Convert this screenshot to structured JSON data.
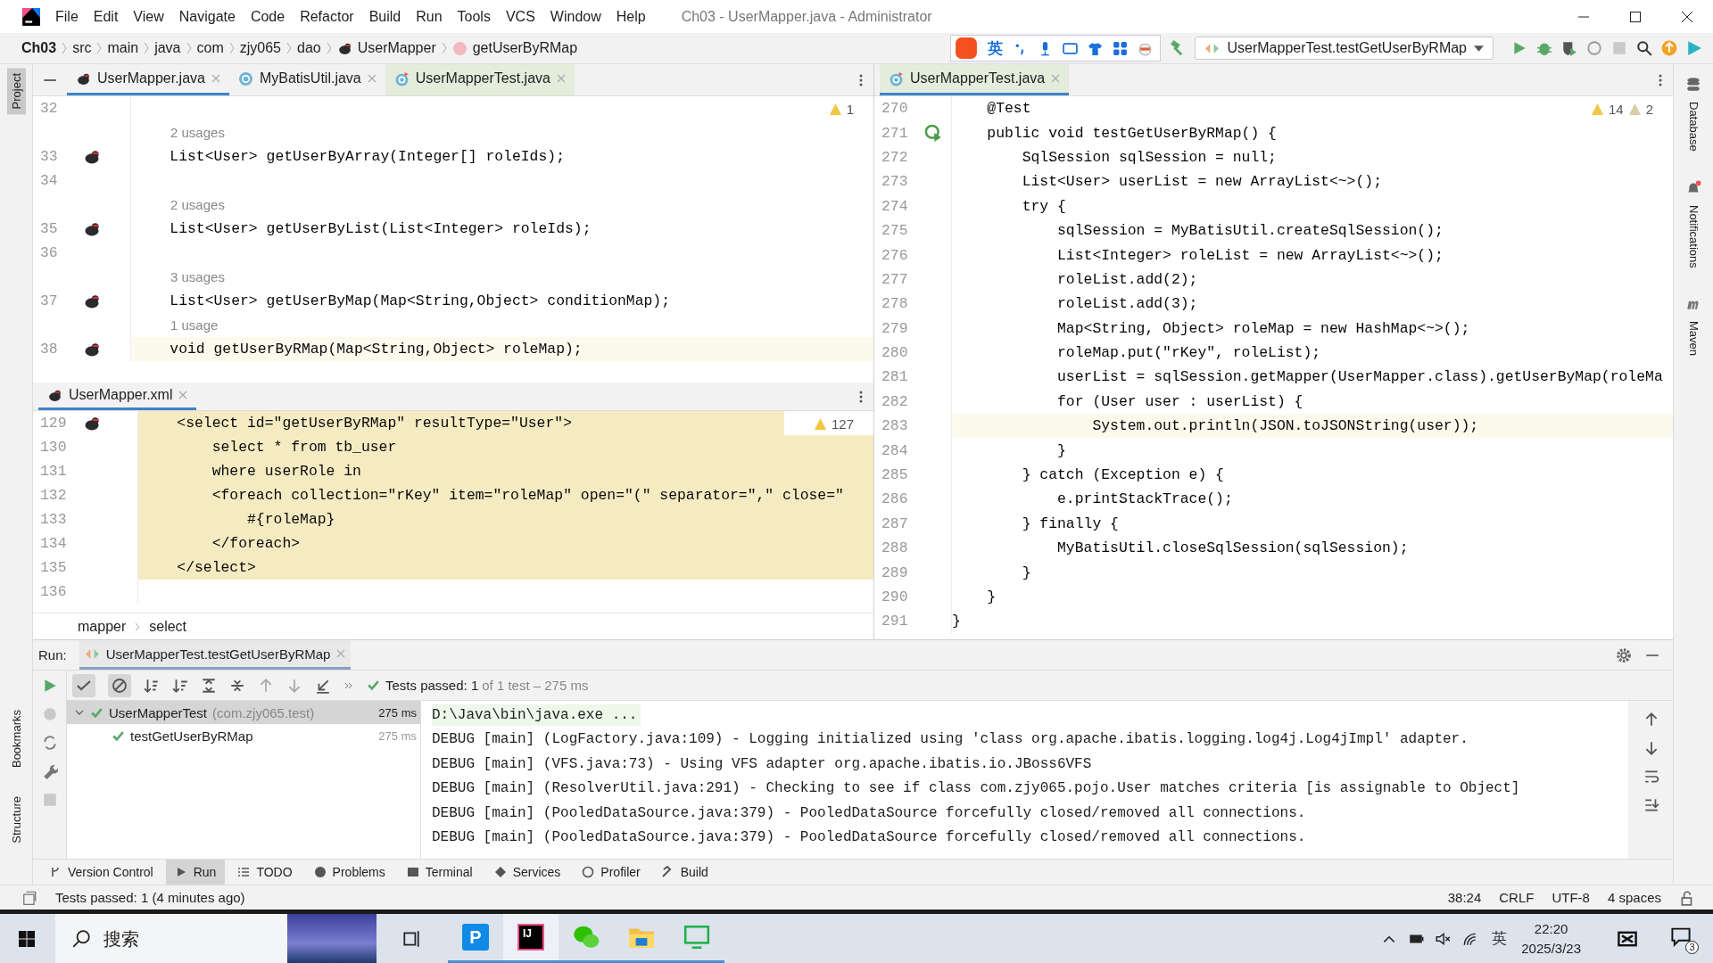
{
  "window": {
    "title": "Ch03 - UserMapper.java - Administrator"
  },
  "menu": [
    "File",
    "Edit",
    "View",
    "Navigate",
    "Code",
    "Refactor",
    "Build",
    "Run",
    "Tools",
    "VCS",
    "Window",
    "Help"
  ],
  "breadcrumb": [
    {
      "label": "Ch03",
      "kind": "project"
    },
    {
      "label": "src",
      "kind": "folder"
    },
    {
      "label": "main",
      "kind": "folder"
    },
    {
      "label": "java",
      "kind": "folder"
    },
    {
      "label": "com",
      "kind": "folder"
    },
    {
      "label": "zjy065",
      "kind": "folder"
    },
    {
      "label": "dao",
      "kind": "folder"
    },
    {
      "label": "UserMapper",
      "kind": "mapper"
    },
    {
      "label": "getUserByRMap",
      "kind": "method"
    }
  ],
  "ime_toolbar": {
    "language": "英"
  },
  "run_config": {
    "label": "UserMapperTest.testGetUserByRMap"
  },
  "left_strip": {
    "top": [
      {
        "label": "Project",
        "selected": true
      }
    ],
    "bottom": [
      {
        "label": "Bookmarks",
        "selected": false
      },
      {
        "label": "Structure",
        "selected": false
      }
    ]
  },
  "right_strip": [
    {
      "label": "Database",
      "kind": "database"
    },
    {
      "label": "Notifications",
      "kind": "bell"
    },
    {
      "label": "Maven",
      "kind": "maven"
    }
  ],
  "left_tabs": [
    {
      "label": "UserMapper.java",
      "selected": true,
      "kind": "mapper"
    },
    {
      "label": "MyBatisUtil.java",
      "selected": false,
      "kind": "class"
    },
    {
      "label": "UserMapperTest.java",
      "selected": false,
      "kind": "test"
    }
  ],
  "right_tabs": [
    {
      "label": "UserMapperTest.java",
      "selected": true,
      "kind": "test"
    }
  ],
  "mapper_editor": {
    "warnings": "1",
    "lines": [
      {
        "number": "32"
      },
      {
        "number": "33",
        "hint": "2 usages",
        "code": "    List<User> getUserByArray(Integer[] roleIds);",
        "mapper_icon": true,
        "current": false
      },
      {
        "number": "34"
      },
      {
        "number": "35",
        "hint": "2 usages",
        "code": "    List<User> getUserByList(List<Integer> roleIds);",
        "mapper_icon": true,
        "current": false
      },
      {
        "number": "36"
      },
      {
        "number": "37",
        "hint": "3 usages",
        "code": "    List<User> getUserByMap(Map<String,Object> conditionMap);",
        "mapper_icon": true,
        "current": false
      },
      {
        "number": "38",
        "hint": "1 usage",
        "code": "    void getUserByRMap(Map<String,Object> roleMap);",
        "mapper_icon": true,
        "current": true
      }
    ]
  },
  "xml_editor": {
    "tab": {
      "label": "UserMapper.xml",
      "selected": true
    },
    "warnings": "127",
    "lines": [
      {
        "number": "129",
        "code": "    <select id=\"getUserByRMap\" resultType=\"User\">",
        "mapper_icon": true,
        "highlighted": true
      },
      {
        "number": "130",
        "code": "        select * from tb_user",
        "highlighted": true
      },
      {
        "number": "131",
        "code": "        where userRole in",
        "highlighted": true
      },
      {
        "number": "132",
        "code": "        <foreach collection=\"rKey\" item=\"roleMap\" open=\"(\" separator=\",\" close=\"",
        "highlighted": true
      },
      {
        "number": "133",
        "code": "            #{roleMap}",
        "highlighted": true
      },
      {
        "number": "134",
        "code": "        </foreach>",
        "highlighted": true
      },
      {
        "number": "135",
        "code": "    </select>",
        "highlighted": true
      },
      {
        "number": "136"
      }
    ],
    "breadcrumb": [
      "mapper",
      "select"
    ]
  },
  "test_editor": {
    "warnings": "14",
    "weak_warnings": "2",
    "lines": [
      {
        "number": "270",
        "code": "    @Test",
        "current": false
      },
      {
        "number": "271",
        "code": "    public void testGetUserByRMap() {",
        "run_icon": true,
        "current": false
      },
      {
        "number": "272",
        "code": "        SqlSession sqlSession = null;",
        "current": false
      },
      {
        "number": "273",
        "code": "        List<User> userList = new ArrayList<~>();",
        "current": false
      },
      {
        "number": "274",
        "code": "        try {",
        "current": false
      },
      {
        "number": "275",
        "code": "            sqlSession = MyBatisUtil.createSqlSession();",
        "current": false
      },
      {
        "number": "276",
        "code": "            List<Integer> roleList = new ArrayList<~>();",
        "current": false
      },
      {
        "number": "277",
        "code": "            roleList.add(2);",
        "current": false
      },
      {
        "number": "278",
        "code": "            roleList.add(3);",
        "current": false
      },
      {
        "number": "279",
        "code": "            Map<String, Object> roleMap = new HashMap<~>();",
        "current": false
      },
      {
        "number": "280",
        "code": "            roleMap.put(\"rKey\", roleList);",
        "current": false
      },
      {
        "number": "281",
        "code": "            userList = sqlSession.getMapper(UserMapper.class).getUserByMap(roleMa",
        "current": false
      },
      {
        "number": "282",
        "code": "            for (User user : userList) {",
        "current": false
      },
      {
        "number": "283",
        "code": "                System.out.println(JSON.toJSONString(user));",
        "current": true
      },
      {
        "number": "284",
        "code": "            }",
        "current": false
      },
      {
        "number": "285",
        "code": "        } catch (Exception e) {",
        "current": false
      },
      {
        "number": "286",
        "code": "            e.printStackTrace();",
        "current": false
      },
      {
        "number": "287",
        "code": "        } finally {",
        "current": false
      },
      {
        "number": "288",
        "code": "            MyBatisUtil.closeSqlSession(sqlSession);",
        "current": false
      },
      {
        "number": "289",
        "code": "        }",
        "current": false
      },
      {
        "number": "290",
        "code": "    }",
        "current": false
      },
      {
        "number": "291",
        "code": "}",
        "current": false
      }
    ]
  },
  "run_panel": {
    "label": "Run:",
    "tab": {
      "label": "UserMapperTest.testGetUserByRMap",
      "selected": true
    },
    "status": {
      "passed": "Tests passed: 1",
      "detail": "of 1 test – 275 ms"
    },
    "tests": [
      {
        "name": "UserMapperTest",
        "package": "(com.zjy065.test)",
        "time": "275 ms",
        "passed": true,
        "expanded": true,
        "selected": true,
        "children": [
          {
            "name": "testGetUserByRMap",
            "time": "275 ms",
            "passed": true,
            "selected": false
          }
        ]
      }
    ],
    "console": [
      "D:\\Java\\bin\\java.exe ...",
      "DEBUG [main] (LogFactory.java:109) - Logging initialized using 'class org.apache.ibatis.logging.log4j.Log4jImpl' adapter.",
      "DEBUG [main] (VFS.java:73) - Using VFS adapter org.apache.ibatis.io.JBoss6VFS",
      "DEBUG [main] (ResolverUtil.java:291) - Checking to see if class com.zjy065.pojo.User matches criteria [is assignable to Object]",
      "DEBUG [main] (PooledDataSource.java:379) - PooledDataSource forcefully closed/removed all connections.",
      "DEBUG [main] (PooledDataSource.java:379) - PooledDataSource forcefully closed/removed all connections."
    ]
  },
  "tool_tabs": [
    {
      "label": "Version Control",
      "kind": "vcs",
      "selected": false
    },
    {
      "label": "Run",
      "kind": "run",
      "selected": true
    },
    {
      "label": "TODO",
      "kind": "todo",
      "selected": false
    },
    {
      "label": "Problems",
      "kind": "problems",
      "selected": false
    },
    {
      "label": "Terminal",
      "kind": "terminal",
      "selected": false
    },
    {
      "label": "Services",
      "kind": "services",
      "selected": false
    },
    {
      "label": "Profiler",
      "kind": "profiler",
      "selected": false
    },
    {
      "label": "Build",
      "kind": "build",
      "selected": false
    }
  ],
  "status_bar": {
    "message": "Tests passed: 1 (4 minutes ago)",
    "items": [
      "38:24",
      "CRLF",
      "UTF-8",
      "4 spaces"
    ]
  },
  "taskbar": {
    "search": {
      "placeholder": "搜索"
    },
    "apps": [
      {
        "kind": "p",
        "label": "P",
        "selected": false
      },
      {
        "kind": "ij",
        "label": "IJ",
        "selected": true
      },
      {
        "kind": "chat",
        "selected": false
      },
      {
        "kind": "folder",
        "selected": false
      },
      {
        "kind": "screen",
        "selected": false
      }
    ],
    "tray_language": "英",
    "time": "22:20",
    "date": "2025/3/23",
    "notifications": "3"
  }
}
